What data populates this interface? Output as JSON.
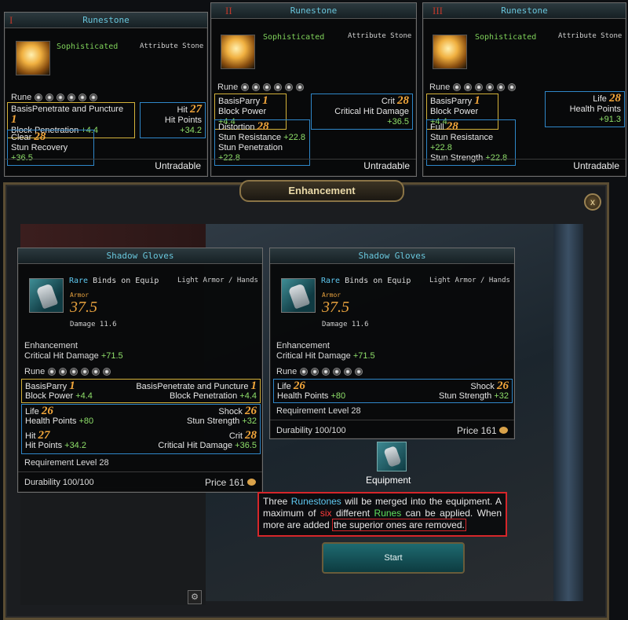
{
  "runestones": [
    {
      "roman": "I",
      "title": "Runestone",
      "grade": "Sophisticated",
      "category": "Attribute Stone",
      "rune_label": "Rune",
      "boxes": [
        {
          "style": "y",
          "name": "BasisPenetrate and Puncture",
          "level": "1",
          "stat": "Block Penetration",
          "value": "+4.4"
        },
        {
          "style": "b",
          "name": "Hit",
          "level": "27",
          "stat": "Hit Points",
          "value": "+34.2"
        },
        {
          "style": "b",
          "name": "Clear",
          "level": "28",
          "stat": "Stun Recovery",
          "value": "+36.5"
        }
      ],
      "untradable": "Untradable"
    },
    {
      "roman": "II",
      "title": "Runestone",
      "grade": "Sophisticated",
      "category": "Attribute Stone",
      "rune_label": "Rune",
      "boxes": [
        {
          "style": "y",
          "name": "BasisParry",
          "level": "1",
          "stat": "Block Power",
          "value": "+4.4"
        },
        {
          "style": "b",
          "name": "Crit",
          "level": "28",
          "stat": "Critical Hit Damage",
          "value": "+36.5"
        },
        {
          "style": "b",
          "name": "Distortion",
          "level": "28",
          "stat": "Stun Resistance",
          "value": "+22.8",
          "stat2": "Stun Penetration",
          "value2": "+22.8"
        }
      ],
      "untradable": "Untradable"
    },
    {
      "roman": "III",
      "title": "Runestone",
      "grade": "Sophisticated",
      "category": "Attribute Stone",
      "rune_label": "Rune",
      "boxes": [
        {
          "style": "y",
          "name": "BasisParry",
          "level": "1",
          "stat": "Block Power",
          "value": "+4.4"
        },
        {
          "style": "b",
          "name": "Life",
          "level": "28",
          "stat": "Health Points",
          "value": "+91.3"
        },
        {
          "style": "b",
          "name": "Full",
          "level": "28",
          "stat": "Stun Resistance",
          "value": "+22.8",
          "stat2": "Stun Strength",
          "value2": "+22.8"
        }
      ],
      "untradable": "Untradable"
    }
  ],
  "window": {
    "title": "Enhancement",
    "close": "x"
  },
  "items": [
    {
      "title": "Shadow Gloves",
      "rarity": "Rare",
      "binds": "Binds on Equip",
      "category": "Light Armor / Hands",
      "armor_label": "Armor",
      "armor": "37.5",
      "damage": "Damage 11.6",
      "enh_label": "Enhancement",
      "enh_stat": "Critical Hit Damage",
      "enh_value": "+71.5",
      "rune_label": "Rune",
      "yellow": [
        {
          "name": "BasisParry",
          "level": "1",
          "stat": "Block Power",
          "value": "+4.4"
        },
        {
          "name": "BasisPenetrate and Puncture",
          "level": "1",
          "stat": "Block Penetration",
          "value": "+4.4"
        }
      ],
      "blue": [
        {
          "name": "Life",
          "level": "26",
          "stat": "Health Points",
          "value": "+80"
        },
        {
          "name": "Shock",
          "level": "26",
          "stat": "Stun Strength",
          "value": "+32"
        },
        {
          "name": "Hit",
          "level": "27",
          "stat": "Hit Points",
          "value": "+34.2"
        },
        {
          "name": "Crit",
          "level": "28",
          "stat": "Critical Hit Damage",
          "value": "+36.5"
        }
      ],
      "req": "Requirement Level 28",
      "durability": "Durability 100/100",
      "price": "Price 161"
    },
    {
      "title": "Shadow Gloves",
      "rarity": "Rare",
      "binds": "Binds on Equip",
      "category": "Light Armor / Hands",
      "armor_label": "Armor",
      "armor": "37.5",
      "damage": "Damage 11.6",
      "enh_label": "Enhancement",
      "enh_stat": "Critical Hit Damage",
      "enh_value": "+71.5",
      "rune_label": "Rune",
      "blue": [
        {
          "name": "Life",
          "level": "26",
          "stat": "Health Points",
          "value": "+80"
        },
        {
          "name": "Shock",
          "level": "26",
          "stat": "Stun Strength",
          "value": "+32"
        }
      ],
      "req": "Requirement Level 28",
      "durability": "Durability 100/100",
      "price": "Price 161"
    }
  ],
  "equipment_label": "Equipment",
  "info": {
    "t1": "Three ",
    "runestones": "Runestones",
    "t2": " will be merged into the equipment. A maximum of ",
    "six": "six",
    "t3": " different ",
    "runes": "Runes",
    "t4": " can be applied. When more are added ",
    "t5": "the superior ones are removed."
  },
  "start_label": "Start",
  "colors": {
    "accent_orange": "#f3a73b",
    "title_cyan": "#69c6dc",
    "stat_green": "#8fe06a",
    "yellow_box": "#d4b23a",
    "blue_box": "#2f87c9",
    "warning_red": "#d6262a"
  }
}
